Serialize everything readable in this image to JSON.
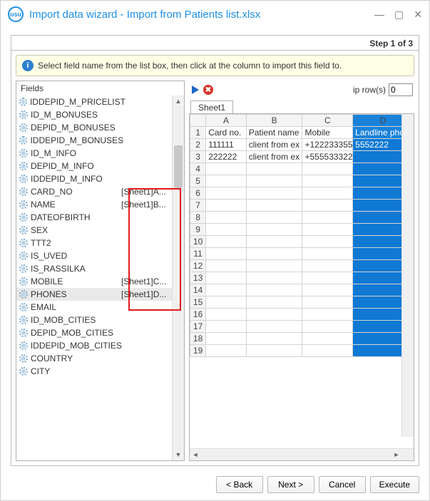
{
  "window": {
    "title": "Import data wizard - Import from Patients list.xlsx",
    "icon_text": "usu"
  },
  "step_indicator": "Step 1 of 3",
  "info_text": "Select field name from the list box, then click at the column to import this field to.",
  "fields_header": "Fields",
  "fields": [
    {
      "name": "IDDEPID_M_PRICELIST",
      "map": ""
    },
    {
      "name": "ID_M_BONUSES",
      "map": ""
    },
    {
      "name": "DEPID_M_BONUSES",
      "map": ""
    },
    {
      "name": "IDDEPID_M_BONUSES",
      "map": ""
    },
    {
      "name": "ID_M_INFO",
      "map": ""
    },
    {
      "name": "DEPID_M_INFO",
      "map": ""
    },
    {
      "name": "IDDEPID_M_INFO",
      "map": ""
    },
    {
      "name": "CARD_NO",
      "map": "[Sheet1]A..."
    },
    {
      "name": "NAME",
      "map": "[Sheet1]B..."
    },
    {
      "name": "DATEOFBIRTH",
      "map": ""
    },
    {
      "name": "SEX",
      "map": ""
    },
    {
      "name": "TTT2",
      "map": ""
    },
    {
      "name": "IS_UVED",
      "map": ""
    },
    {
      "name": "IS_RASSILKA",
      "map": ""
    },
    {
      "name": "MOBILE",
      "map": "[Sheet1]C..."
    },
    {
      "name": "PHONES",
      "map": "[Sheet1]D...",
      "selected": true
    },
    {
      "name": "EMAIL",
      "map": ""
    },
    {
      "name": "ID_MOB_CITIES",
      "map": ""
    },
    {
      "name": "DEPID_MOB_CITIES",
      "map": ""
    },
    {
      "name": "IDDEPID_MOB_CITIES",
      "map": ""
    },
    {
      "name": "COUNTRY",
      "map": ""
    },
    {
      "name": "CITY",
      "map": ""
    }
  ],
  "skip_rows": {
    "label": "ip row(s)",
    "value": "0"
  },
  "tabs": [
    "Sheet1"
  ],
  "grid": {
    "col_letters": [
      "A",
      "B",
      "C",
      "D"
    ],
    "selected_col_index": 3,
    "headers": [
      "Card no.",
      "Patient name",
      "Mobile",
      "Landline phon"
    ],
    "rows": [
      [
        "111111",
        "client from ex",
        "+122233355",
        "5552222"
      ],
      [
        "222222",
        "client from ex",
        "+555533322",
        ""
      ]
    ],
    "total_visible_rows": 19
  },
  "buttons": {
    "back": "< Back",
    "next": "Next >",
    "cancel": "Cancel",
    "execute": "Execute"
  }
}
